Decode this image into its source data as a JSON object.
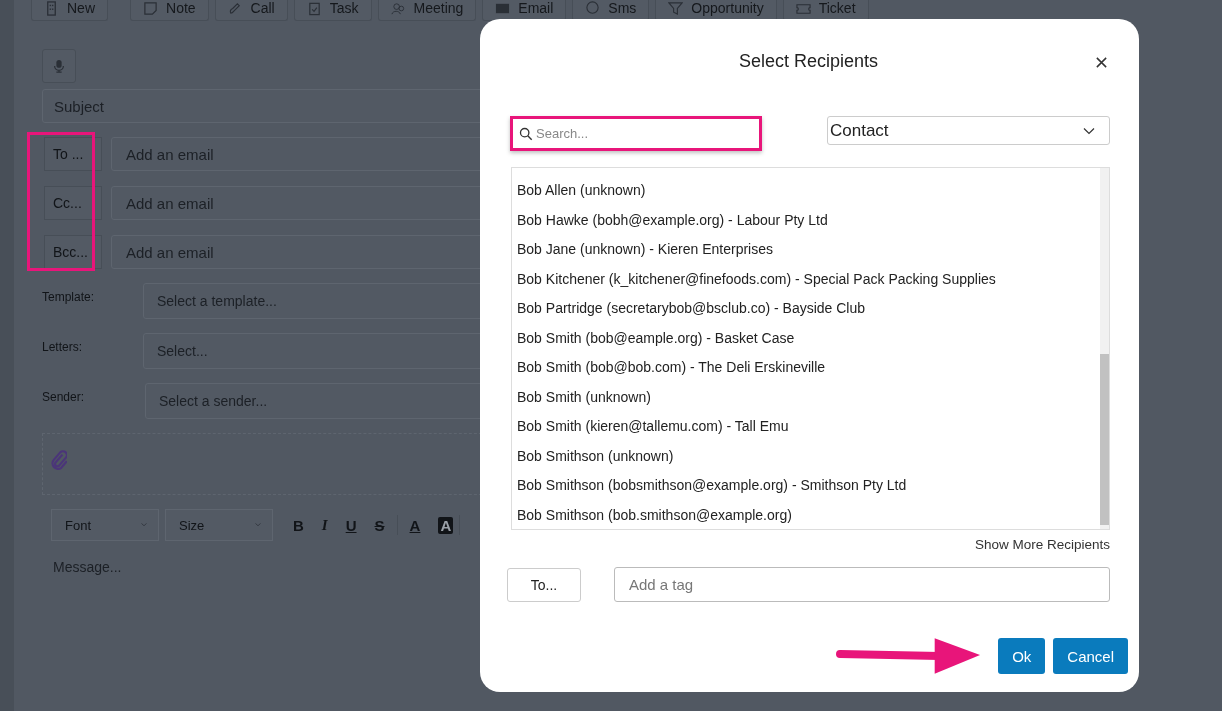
{
  "toolbar": [
    {
      "label": "New"
    },
    {
      "label": "Note"
    },
    {
      "label": "Call"
    },
    {
      "label": "Task"
    },
    {
      "label": "Meeting"
    },
    {
      "label": "Email"
    },
    {
      "label": "Sms"
    },
    {
      "label": "Opportunity"
    },
    {
      "label": "Ticket"
    }
  ],
  "subject": {
    "placeholder": "Subject"
  },
  "recipients": [
    {
      "button": "To ...",
      "placeholder": "Add an email"
    },
    {
      "button": "Cc...",
      "placeholder": "Add an email"
    },
    {
      "button": "Bcc...",
      "placeholder": "Add an email"
    }
  ],
  "selects": [
    {
      "label": "Template:",
      "placeholder": "Select a template..."
    },
    {
      "label": "Letters:",
      "placeholder": "Select..."
    },
    {
      "label": "Sender:",
      "placeholder": "Select a sender..."
    }
  ],
  "editor": {
    "font": "Font",
    "size": "Size",
    "format_buttons": [
      "B",
      "I",
      "U",
      "S"
    ],
    "color_buttons": [
      "A",
      "A"
    ],
    "message_placeholder": "Message..."
  },
  "dialog": {
    "title": "Select Recipients",
    "search": {
      "placeholder": "Search..."
    },
    "type_select": "Contact",
    "contacts": [
      "Bob Allen (unknown)",
      "Bob Hawke (bobh@example.org) - Labour Pty Ltd",
      "Bob Jane (unknown) - Kieren Enterprises",
      "Bob Kitchener (k_kitchener@finefoods.com) - Special Pack Packing Supplies",
      "Bob Partridge (secretarybob@bsclub.co) - Bayside Club",
      "Bob Smith (bob@eample.org) - Basket Case",
      "Bob Smith (bob@bob.com) - The Deli Erskineville",
      "Bob Smith (unknown)",
      "Bob Smith (kieren@tallemu.com) - Tall Emu",
      "Bob Smithson (unknown)",
      "Bob Smithson (bobsmithson@example.org) - Smithson Pty Ltd",
      "Bob Smithson (bob.smithson@example.org)"
    ],
    "show_more": "Show More Recipients",
    "to_button": "To...",
    "tag_field": {
      "placeholder": "Add a tag"
    },
    "buttons": [
      {
        "label": "Ok",
        "kind": "primary"
      },
      {
        "label": "Cancel",
        "kind": "primary"
      }
    ]
  }
}
